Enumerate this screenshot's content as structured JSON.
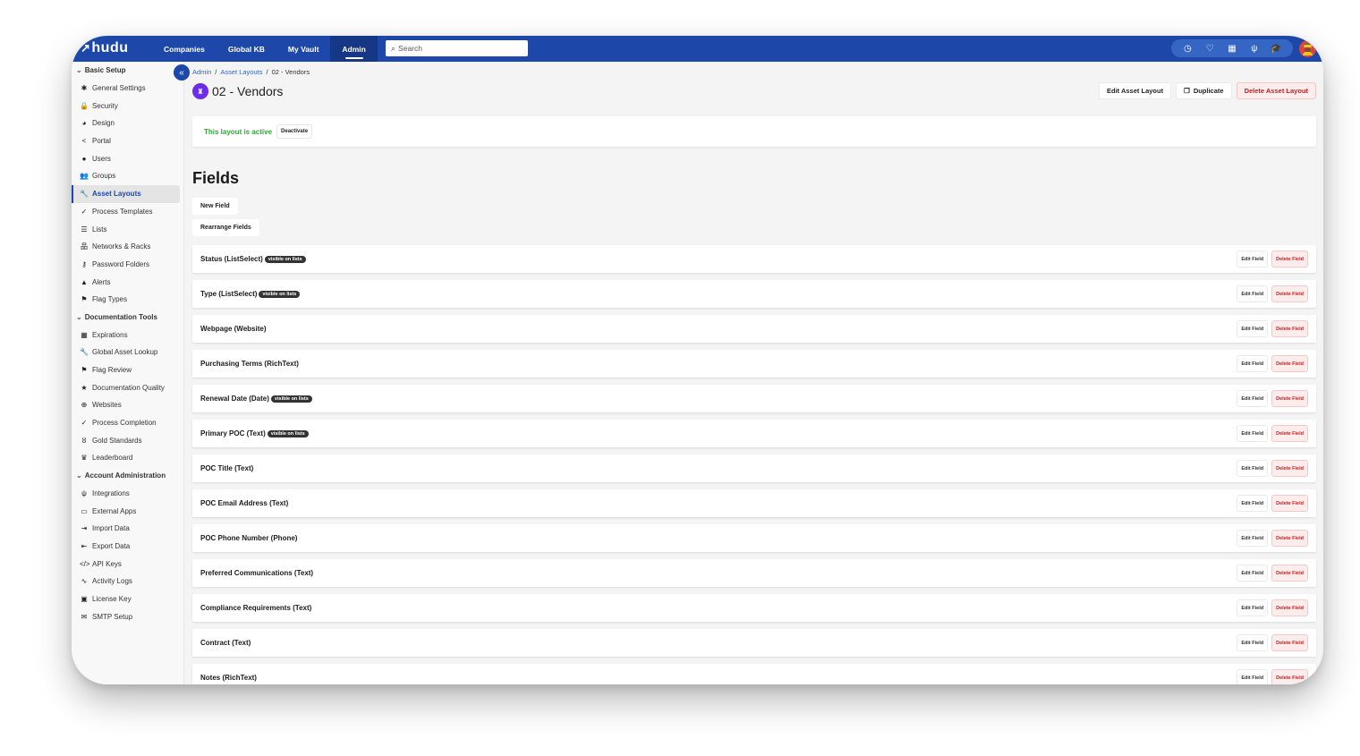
{
  "topbar": {
    "logo": "hudu",
    "nav": [
      {
        "label": "Companies",
        "active": false
      },
      {
        "label": "Global KB",
        "active": false
      },
      {
        "label": "My Vault",
        "active": false
      },
      {
        "label": "Admin",
        "active": true
      }
    ],
    "search_placeholder": "Search",
    "icons": [
      "clock-icon",
      "heart-icon",
      "calendar-icon",
      "plug-check-icon",
      "graduation-cap-icon"
    ]
  },
  "sidebar": {
    "sections": [
      {
        "title": "Basic Setup",
        "items": [
          {
            "label": "General Settings",
            "icon": "gear-icon",
            "glyph": "✱"
          },
          {
            "label": "Security",
            "icon": "lock-icon",
            "glyph": "🔒"
          },
          {
            "label": "Design",
            "icon": "palette-icon",
            "glyph": "◕"
          },
          {
            "label": "Portal",
            "icon": "share-icon",
            "glyph": "<"
          },
          {
            "label": "Users",
            "icon": "user-icon",
            "glyph": "●"
          },
          {
            "label": "Groups",
            "icon": "users-icon",
            "glyph": "👥"
          },
          {
            "label": "Asset Layouts",
            "icon": "wrench-icon",
            "glyph": "🔧",
            "active": true
          },
          {
            "label": "Process Templates",
            "icon": "check-icon",
            "glyph": "✓"
          },
          {
            "label": "Lists",
            "icon": "list-icon",
            "glyph": "☰"
          },
          {
            "label": "Networks & Racks",
            "icon": "network-icon",
            "glyph": "品"
          },
          {
            "label": "Password Folders",
            "icon": "key-icon",
            "glyph": "⚷"
          },
          {
            "label": "Alerts",
            "icon": "bell-icon",
            "glyph": "▲"
          },
          {
            "label": "Flag Types",
            "icon": "flag-icon",
            "glyph": "⚑"
          }
        ]
      },
      {
        "title": "Documentation Tools",
        "items": [
          {
            "label": "Expirations",
            "icon": "calendar-icon",
            "glyph": "▦"
          },
          {
            "label": "Global Asset Lookup",
            "icon": "wrench-icon",
            "glyph": "🔧"
          },
          {
            "label": "Flag Review",
            "icon": "flag-icon",
            "glyph": "⚑"
          },
          {
            "label": "Documentation Quality",
            "icon": "star-icon",
            "glyph": "★"
          },
          {
            "label": "Websites",
            "icon": "globe-icon",
            "glyph": "⊕"
          },
          {
            "label": "Process Completion",
            "icon": "check-icon",
            "glyph": "✓"
          },
          {
            "label": "Gold Standards",
            "icon": "medal-icon",
            "glyph": "ȣ"
          },
          {
            "label": "Leaderboard",
            "icon": "trophy-icon",
            "glyph": "♛"
          }
        ]
      },
      {
        "title": "Account Administration",
        "items": [
          {
            "label": "Integrations",
            "icon": "plug-icon",
            "glyph": "ψ"
          },
          {
            "label": "External Apps",
            "icon": "devices-icon",
            "glyph": "▭"
          },
          {
            "label": "Import Data",
            "icon": "file-import-icon",
            "glyph": "⇥"
          },
          {
            "label": "Export Data",
            "icon": "file-export-icon",
            "glyph": "⇤"
          },
          {
            "label": "API Keys",
            "icon": "code-icon",
            "glyph": "</>"
          },
          {
            "label": "Activity Logs",
            "icon": "activity-icon",
            "glyph": "∿"
          },
          {
            "label": "License Key",
            "icon": "id-card-icon",
            "glyph": "▣"
          },
          {
            "label": "SMTP Setup",
            "icon": "envelope-icon",
            "glyph": "✉"
          }
        ]
      }
    ]
  },
  "breadcrumb": [
    {
      "label": "Admin",
      "link": true
    },
    {
      "label": "Asset Layouts",
      "link": true
    },
    {
      "label": "02 - Vendors",
      "link": false
    }
  ],
  "page": {
    "title": "02 - Vendors",
    "actions": {
      "edit": "Edit Asset Layout",
      "duplicate": "Duplicate",
      "delete": "Delete Asset Layout"
    },
    "status_text": "This layout is active",
    "deactivate": "Deactivate",
    "fields_heading": "Fields",
    "new_field": "New Field",
    "rearrange_fields": "Rearrange Fields",
    "edit_field_label": "Edit Field",
    "delete_field_label": "Delete Field",
    "visible_badge": "visible on lists",
    "fields": [
      {
        "name": "Status (ListSelect)",
        "visible_on_lists": true
      },
      {
        "name": "Type (ListSelect)",
        "visible_on_lists": true
      },
      {
        "name": "Webpage (Website)",
        "visible_on_lists": false
      },
      {
        "name": "Purchasing Terms (RichText)",
        "visible_on_lists": false
      },
      {
        "name": "Renewal Date (Date)",
        "visible_on_lists": true
      },
      {
        "name": "Primary POC (Text)",
        "visible_on_lists": true
      },
      {
        "name": "POC Title (Text)",
        "visible_on_lists": false
      },
      {
        "name": "POC Email Address (Text)",
        "visible_on_lists": false
      },
      {
        "name": "POC Phone Number (Phone)",
        "visible_on_lists": false
      },
      {
        "name": "Preferred Communications (Text)",
        "visible_on_lists": false
      },
      {
        "name": "Compliance Requirements (Text)",
        "visible_on_lists": false
      },
      {
        "name": "Contract (Text)",
        "visible_on_lists": false
      },
      {
        "name": "Notes (RichText)",
        "visible_on_lists": false
      }
    ]
  },
  "colors": {
    "brand": "#1d47a8",
    "active_green": "#35a537",
    "danger": "#c42020",
    "badge": "#6d2bea"
  }
}
